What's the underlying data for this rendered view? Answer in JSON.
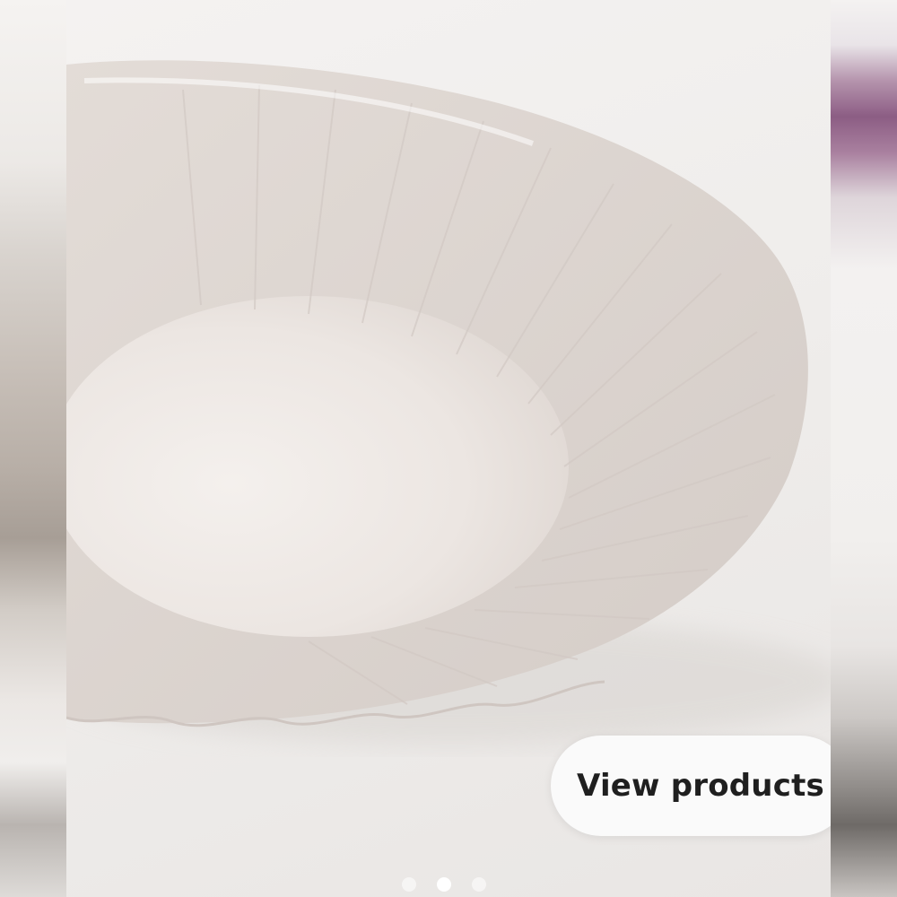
{
  "carousel": {
    "cta_label": "View products",
    "total_slides": 3,
    "active_slide": 2,
    "image_subject": "plate-image"
  }
}
